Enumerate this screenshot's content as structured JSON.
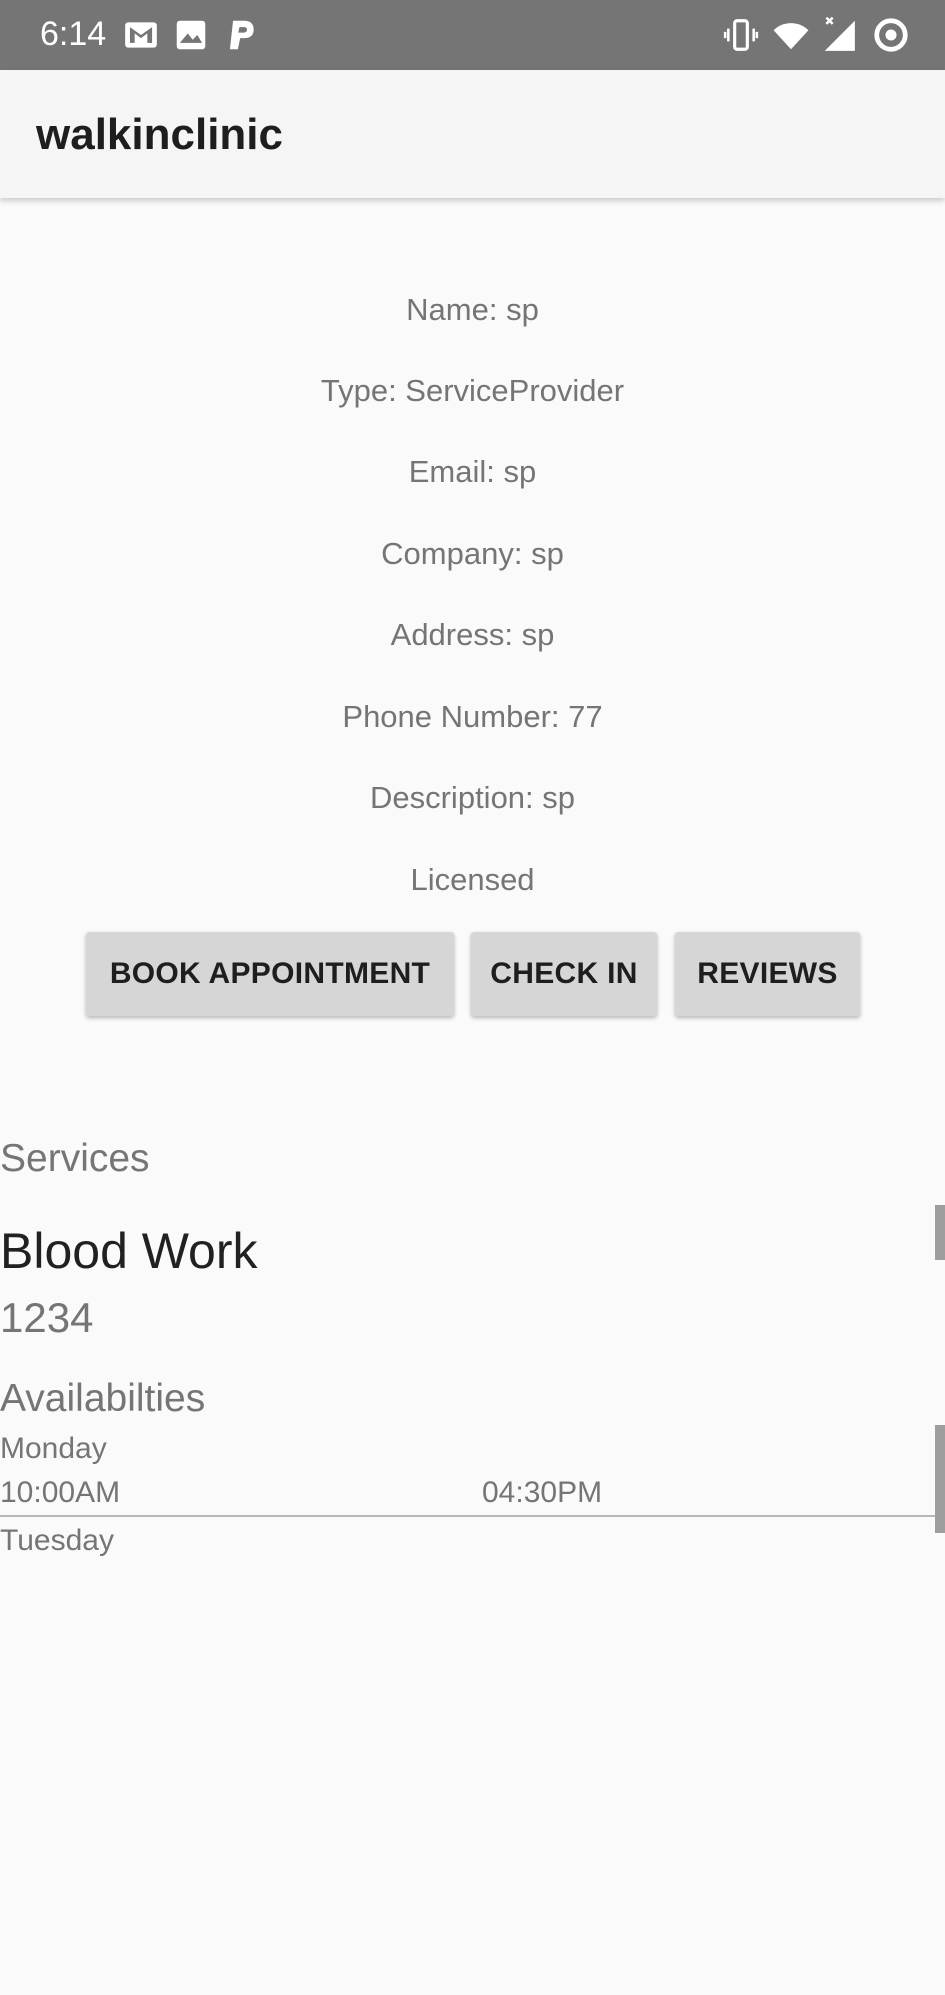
{
  "status_bar": {
    "time": "6:14",
    "left_icons": [
      "gmail-icon",
      "image-icon",
      "p-notification-icon"
    ],
    "right_icons": [
      "vibrate-icon",
      "wifi-icon",
      "cell-signal-icon",
      "sync-circle-icon"
    ]
  },
  "app_bar": {
    "title": "walkinclinic"
  },
  "profile": {
    "name": "Name: sp",
    "type": "Type: ServiceProvider",
    "email": "Email: sp",
    "company": "Company: sp",
    "address": "Address: sp",
    "phone": "Phone Number: 77",
    "description": "Description: sp",
    "licensed": "Licensed"
  },
  "actions": {
    "book": "BOOK APPOINTMENT",
    "checkin": "CHECK IN",
    "reviews": "REVIEWS"
  },
  "services": {
    "heading": "Services",
    "items": [
      {
        "name": "Blood Work",
        "price": "1234"
      }
    ]
  },
  "availabilities": {
    "heading": "Availabilties",
    "days": [
      {
        "day": "Monday",
        "start": "10:00AM",
        "end": "04:30PM"
      },
      {
        "day": "Tuesday"
      }
    ]
  },
  "colors": {
    "status_bar": "#757575",
    "app_bar": "#f5f5f5",
    "background": "#fafafa",
    "button": "#d6d6d6",
    "muted_text": "#757575",
    "dark_text": "#212121"
  }
}
